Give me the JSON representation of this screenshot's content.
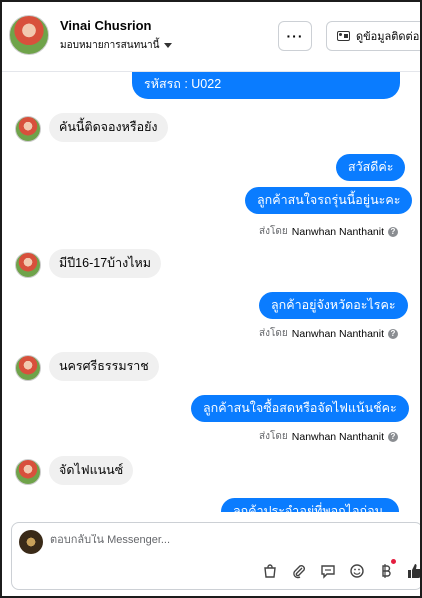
{
  "header": {
    "name": "Vinai Chusrion",
    "assign_label": "มอบหมายการสนทนานี้",
    "more_label": "···",
    "contact_label": "ดูข้อมูลติดต่อ"
  },
  "messages": {
    "m1": "รหัสรถ : U022",
    "m2": "คันนี้ติดจองหรือยัง",
    "m3": "สวัสดีค่ะ",
    "m4": "ลูกค้าสนใจรถรุ่นนี้อยู่นะคะ",
    "m5": "มีปี16-17บ้างไหม",
    "m6": "ลูกค้าอยู่จังหวัดอะไรคะ",
    "m7": "นครศรีธรรมราช",
    "m8": "ลูกค้าสนใจซื้อสดหรือจัดไฟแน้นช์คะ",
    "m9": "จัดไฟแนนซ์",
    "m10": "ลูกค้าประจำอยู่ที่พอกไอก่อน"
  },
  "sent_by": {
    "prefix": "ส่งโดย",
    "agent": "Nanwhan Nanthanit",
    "help": "?"
  },
  "composer": {
    "placeholder": "ตอบกลับใน Messenger..."
  },
  "icons": {
    "more": "more-icon",
    "contact": "contact-card-icon",
    "bag": "shopping-bag-icon",
    "attach": "paperclip-icon",
    "saved_reply": "saved-reply-icon",
    "emoji": "emoji-icon",
    "payment": "baht-icon",
    "like": "thumbs-up-icon"
  },
  "colors": {
    "outgoing": "#0a7cff",
    "incoming": "#f0f0f0",
    "notification": "#e41e3f"
  }
}
